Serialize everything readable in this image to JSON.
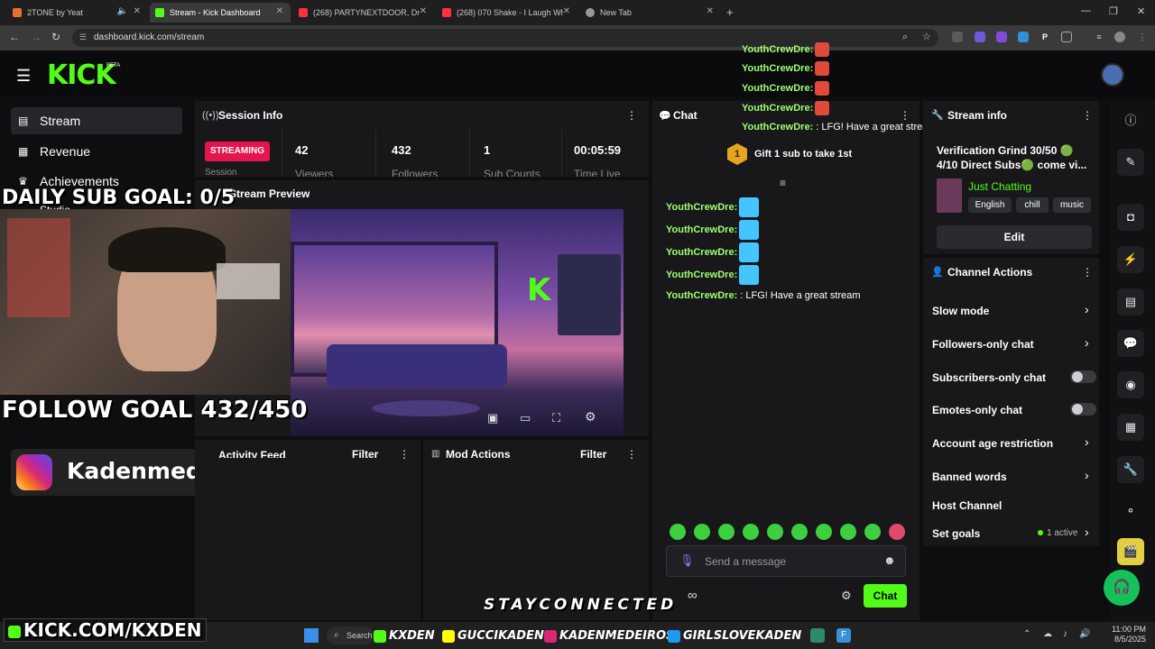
{
  "browser": {
    "tabs": [
      {
        "title": "2TONE by Yeat",
        "fav": "#e8702a"
      },
      {
        "title": "Stream - Kick Dashboard",
        "fav": "#53fc18"
      },
      {
        "title": "(268) PARTYNEXTDOOR, Drake",
        "fav": "#ff3040"
      },
      {
        "title": "(268) 070 Shake - I Laugh When",
        "fav": "#ff3040"
      },
      {
        "title": "New Tab",
        "fav": "#999999"
      }
    ],
    "url": "dashboard.kick.com/stream"
  },
  "kick": {
    "logo": "KICK",
    "beta": "BETA",
    "sidebar": [
      "Stream",
      "Revenue",
      "Achievements",
      "Studio"
    ]
  },
  "session": {
    "title": "Session Info",
    "status": "STREAMING",
    "session_label": "Session",
    "stats": [
      {
        "value": "42",
        "label": "Viewers"
      },
      {
        "value": "432",
        "label": "Followers"
      },
      {
        "value": "1",
        "label": "Sub Counts"
      },
      {
        "value": "00:05:59",
        "label": "Time Live"
      }
    ]
  },
  "preview": {
    "title": "Stream Preview"
  },
  "activity": {
    "title": "Activity Feed",
    "filter": "Filter"
  },
  "mod": {
    "title": "Mod Actions",
    "filter": "Filter"
  },
  "chat": {
    "title": "Chat",
    "gift": "Gift 1 sub to take 1st",
    "gift_num": "1",
    "user": "YouthCrewDre:",
    "last_message": ": LFG! Have a great stream",
    "placeholder": "Send a message",
    "send": "Chat"
  },
  "stream_info": {
    "title": "Stream info",
    "stream_title": "Verification Grind 30/50 🟢 4/10 Direct Subs🟢 come vi...",
    "category": "Just Chatting",
    "tags": [
      "English",
      "chill",
      "music"
    ],
    "edit": "Edit"
  },
  "channel_actions": {
    "title": "Channel Actions",
    "items": [
      "Slow mode",
      "Followers-only chat",
      "Subscribers-only chat",
      "Emotes-only chat",
      "Account age restriction",
      "Banned words",
      "Host Channel",
      "Set goals"
    ],
    "goals_badge": "1 active"
  },
  "overlay": {
    "daily_sub": "DAILY SUB GOAL: 0/5",
    "follow_goal": "FOLLOW GOAL 432/450",
    "instagram": "Kadenmedeiros",
    "stay": "STAYCONNECTED",
    "kick_url": "KICK.COM/KXDEN",
    "socials": [
      "KXDEN",
      "GUCCIKADEN",
      "KADENMEDEIROS",
      "GIRLSLOVEKADEN"
    ]
  },
  "taskbar": {
    "search": "Search",
    "time": "11:00 PM",
    "date": "8/5/2025"
  },
  "colors": {
    "kick_green": "#53fc18",
    "streaming_red": "#e5154e",
    "panel": "#18181b"
  }
}
